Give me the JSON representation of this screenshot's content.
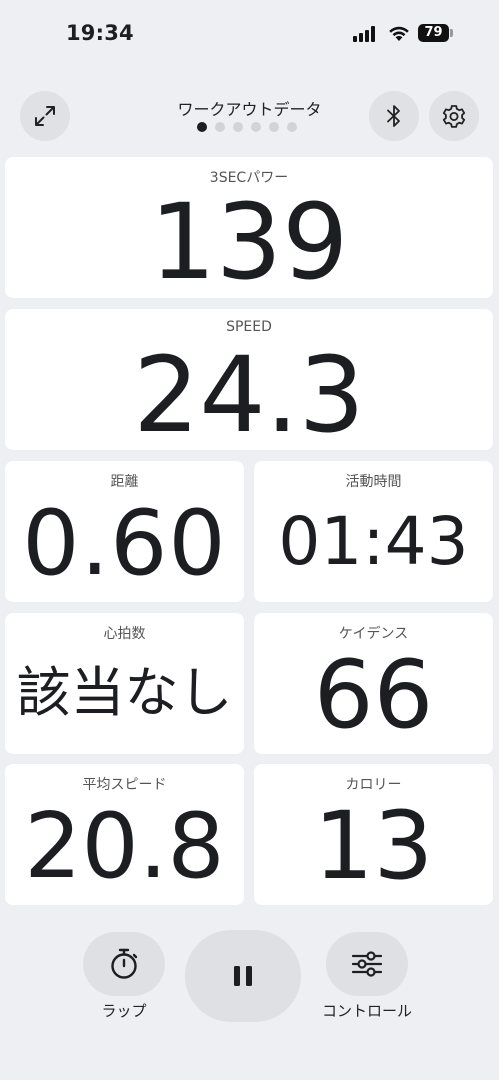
{
  "status_bar": {
    "time": "19:34",
    "battery": "79"
  },
  "header": {
    "title": "ワークアウトデータ",
    "page_count": 6,
    "active_page": 1,
    "icons": [
      "expand-icon",
      "bluetooth-icon",
      "gear-icon"
    ]
  },
  "tiles": {
    "power": {
      "label": "3SECパワー",
      "value": "139"
    },
    "speed": {
      "label": "SPEED",
      "value": "24.3"
    },
    "distance": {
      "label": "距離",
      "value": "0.60"
    },
    "active_time": {
      "label": "活動時間",
      "value": "01:43"
    },
    "heart_rate": {
      "label": "心拍数",
      "value": "該当なし"
    },
    "cadence": {
      "label": "ケイデンス",
      "value": "66"
    },
    "avg_speed": {
      "label": "平均スピード",
      "value": "20.8"
    },
    "calories": {
      "label": "カロリー",
      "value": "13"
    }
  },
  "controls": {
    "lap_label": "ラップ",
    "control_label": "コントロール",
    "icons": [
      "stopwatch-icon",
      "pause-icon",
      "sliders-icon"
    ]
  },
  "colors": {
    "background": "#eeeff2",
    "tile": "#ffffff",
    "button": "#e0e1e5",
    "text": "#1c1e21"
  }
}
